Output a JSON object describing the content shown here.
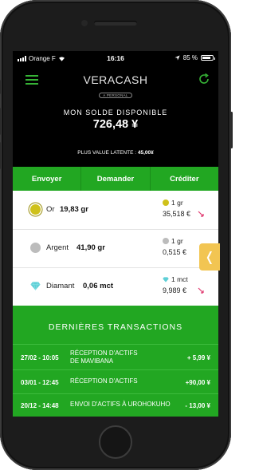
{
  "status_bar": {
    "carrier": "Orange F",
    "time": "16:16",
    "battery": "85 %",
    "battery_level": 0.85
  },
  "header": {
    "app_name": "VERACASH",
    "app_sub": "A PERSONAL"
  },
  "balance": {
    "label": "MON SOLDE DISPONIBLE",
    "value": "726,48 ¥"
  },
  "latent": {
    "label": "PLUS VALUE LATENTE :",
    "value": "45,00¥"
  },
  "tabs": [
    {
      "label": "Envoyer"
    },
    {
      "label": "Demander"
    },
    {
      "label": "Créditer"
    }
  ],
  "assets": [
    {
      "name": "Or",
      "qty": "19,83 gr",
      "unit": "1 gr",
      "price": "35,518 €",
      "color": "#cfc11b",
      "trend": "down"
    },
    {
      "name": "Argent",
      "qty": "41,90 gr",
      "unit": "1 gr",
      "price": "0,515 €",
      "color": "#bcbcbc",
      "trend": ""
    },
    {
      "name": "Diamant",
      "qty": "0,06 mct",
      "unit": "1 mct",
      "price": "9,989 €",
      "color": "#5ecfd6",
      "trend": "down"
    }
  ],
  "sidetab": {
    "icon": "chevron-left-icon",
    "glyph": "❬"
  },
  "transactions": {
    "title": "DERNIÈRES TRANSACTIONS",
    "items": [
      {
        "date": "27/02 - 10:05",
        "label_line1": "RÉCEPTION D'ACTIFS",
        "label_line2": "DE MAVIBANA",
        "amount": "+ 5,99 ¥"
      },
      {
        "date": "03/01 - 12:45",
        "label_line1": "RÉCEPTION D'ACTIFS",
        "label_line2": "",
        "amount": "+90,00 ¥"
      },
      {
        "date": "20/12 - 14:48",
        "label_line1": "ENVOI D'ACTIFS À UROHOKUHO",
        "label_line2": "",
        "amount": "- 13,00 ¥"
      }
    ]
  },
  "colors": {
    "accent": "#22a722",
    "trend_down": "#e0396f",
    "sidetab": "#f2c552"
  }
}
